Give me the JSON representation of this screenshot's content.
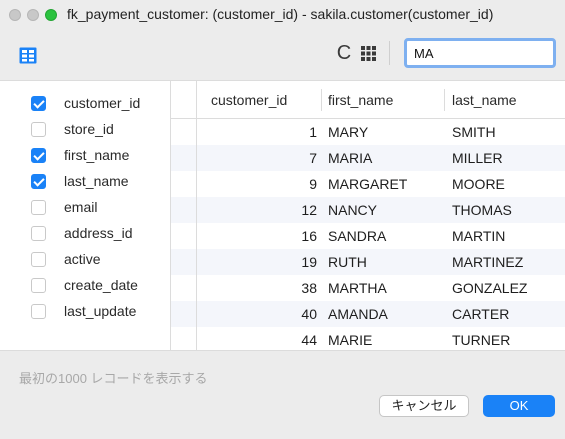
{
  "window": {
    "title": "fk_payment_customer: (customer_id) - sakila.customer(customer_id)"
  },
  "toolbar": {
    "layout_icon": "table-layout-icon",
    "refresh_icon": "refresh-icon",
    "refresh_glyph": "C",
    "columns_icon": "columns-grid-icon",
    "search_value": "MA"
  },
  "fields": [
    {
      "label": "customer_id",
      "checked": true
    },
    {
      "label": "store_id",
      "checked": false
    },
    {
      "label": "first_name",
      "checked": true
    },
    {
      "label": "last_name",
      "checked": true
    },
    {
      "label": "email",
      "checked": false
    },
    {
      "label": "address_id",
      "checked": false
    },
    {
      "label": "active",
      "checked": false
    },
    {
      "label": "create_date",
      "checked": false
    },
    {
      "label": "last_update",
      "checked": false
    }
  ],
  "table": {
    "columns": [
      "customer_id",
      "first_name",
      "last_name"
    ],
    "rows": [
      [
        "1",
        "MARY",
        "SMITH"
      ],
      [
        "7",
        "MARIA",
        "MILLER"
      ],
      [
        "9",
        "MARGARET",
        "MOORE"
      ],
      [
        "12",
        "NANCY",
        "THOMAS"
      ],
      [
        "16",
        "SANDRA",
        "MARTIN"
      ],
      [
        "19",
        "RUTH",
        "MARTINEZ"
      ],
      [
        "38",
        "MARTHA",
        "GONZALEZ"
      ],
      [
        "40",
        "AMANDA",
        "CARTER"
      ],
      [
        "44",
        "MARIE",
        "TURNER"
      ]
    ]
  },
  "footer": {
    "status": "最初の1000 レコードを表示する",
    "cancel_label": "キャンセル",
    "ok_label": "OK"
  },
  "colors": {
    "accent": "#1a82f7",
    "alt_row": "#f4f6fb",
    "traffic_green": "#2bc23f"
  }
}
